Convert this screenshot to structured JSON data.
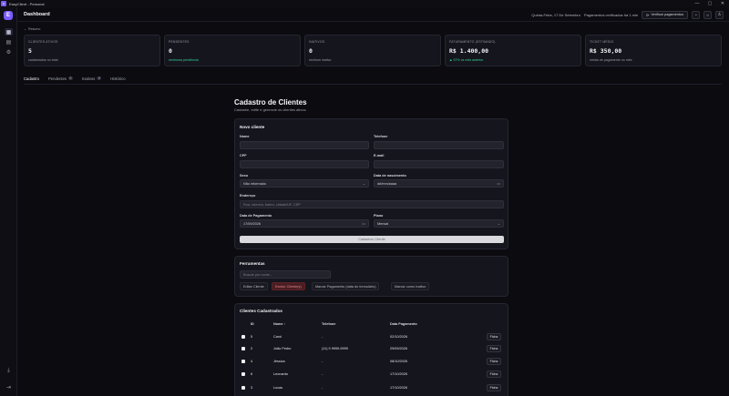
{
  "window": {
    "app_title": "EasyClient - Personal",
    "logo_letter": "E",
    "controls": [
      "—",
      "▢",
      "✕"
    ]
  },
  "rail": {
    "logo_letter": "E",
    "icons": [
      "dashboard-icon",
      "document-icon",
      "settings-icon"
    ],
    "bottom_icons": [
      "download-icon",
      "logout-icon"
    ]
  },
  "header": {
    "title": "Dashboard",
    "date": "Quinta-Feira, 17 De Setembro",
    "sync_status": "Pagamentos verificados há 1 min",
    "check_button": "Verificar pagamentos",
    "icon_buttons": [
      "bell-icon",
      "sun-icon",
      "user-icon"
    ]
  },
  "summary": {
    "toggle_label": "Resumo",
    "cards": [
      {
        "label": "CLIENTES ATIVOS",
        "value": "5",
        "sub": "cadastrados no total",
        "sub_color": "muted"
      },
      {
        "label": "PENDENTES",
        "value": "0",
        "sub": "nenhuma pendência",
        "sub_color": "green"
      },
      {
        "label": "INATIVOS",
        "value": "0",
        "sub": "nenhum inativo",
        "sub_color": "muted"
      },
      {
        "label": "FATURAMENTO (ESTIMADO)",
        "value": "R$ 1.400,00",
        "sub": "▲ 97% vs mês anterior",
        "sub_color": "green"
      },
      {
        "label": "TICKET MÉDIO",
        "value": "R$ 350,00",
        "sub": "média de pagamento no mês",
        "sub_color": "muted"
      }
    ]
  },
  "tabs": [
    {
      "label": "Cadastro",
      "count": null,
      "active": true
    },
    {
      "label": "Pendentes",
      "count": "0",
      "active": false
    },
    {
      "label": "Inativos",
      "count": "0",
      "active": false
    },
    {
      "label": "Histórico",
      "count": null,
      "active": false
    }
  ],
  "page": {
    "title": "Cadastro de Clientes",
    "subtitle": "Cadastre, edite e gerencie os clientes ativos."
  },
  "new_client": {
    "title": "Novo cliente",
    "name_label": "Nome",
    "name_value": "",
    "phone_label": "Telefone",
    "phone_value": "",
    "cpf_label": "CPF",
    "cpf_value": "",
    "email_label": "E-mail",
    "email_value": "",
    "sex_label": "Sexo",
    "sex_value": "Não informado",
    "birth_label": "Data de nascimento",
    "birth_placeholder": "dd/mm/aaaa",
    "address_label": "Endereço",
    "address_placeholder": "Rua, número, bairro, cidade/UF, CEP",
    "pay_date_label": "Data de Pagamento",
    "pay_date_value": "17/09/2026",
    "plan_label": "Plano",
    "plan_value": "Mensal",
    "submit_label": "Cadastrar Cliente"
  },
  "tools": {
    "title": "Ferramentas",
    "search_placeholder": "Buscar por nome...",
    "buttons": [
      "Editar Cliente",
      "Excluir Cliente(s)",
      "Marcar Pagamento (data do formulário)",
      "Marcar como Inativo"
    ]
  },
  "clients": {
    "title": "Clientes Cadastrados",
    "headers": {
      "id": "ID",
      "name": "Nome ↑",
      "phone": "Telefone",
      "pay_date": "Data Pagamento"
    },
    "rows": [
      {
        "id": "5",
        "name": "Carol",
        "phone": "-",
        "pay_date": "02/10/2026",
        "action": "Ficha"
      },
      {
        "id": "2",
        "name": "João Pedro",
        "phone": "(11) 9 9999-9999",
        "pay_date": "29/09/2026",
        "action": "Ficha"
      },
      {
        "id": "4",
        "name": "Jéssica",
        "phone": "-",
        "pay_date": "08/10/2026",
        "action": "Ficha"
      },
      {
        "id": "6",
        "name": "Leonardo",
        "phone": "-",
        "pay_date": "17/10/2026",
        "action": "Ficha"
      },
      {
        "id": "3",
        "name": "Lucas",
        "phone": "-",
        "pay_date": "17/10/2026",
        "action": "Ficha"
      }
    ]
  },
  "colors": {
    "accent": "#7c5cff",
    "positive": "#34d399",
    "danger": "#4a1d22"
  }
}
